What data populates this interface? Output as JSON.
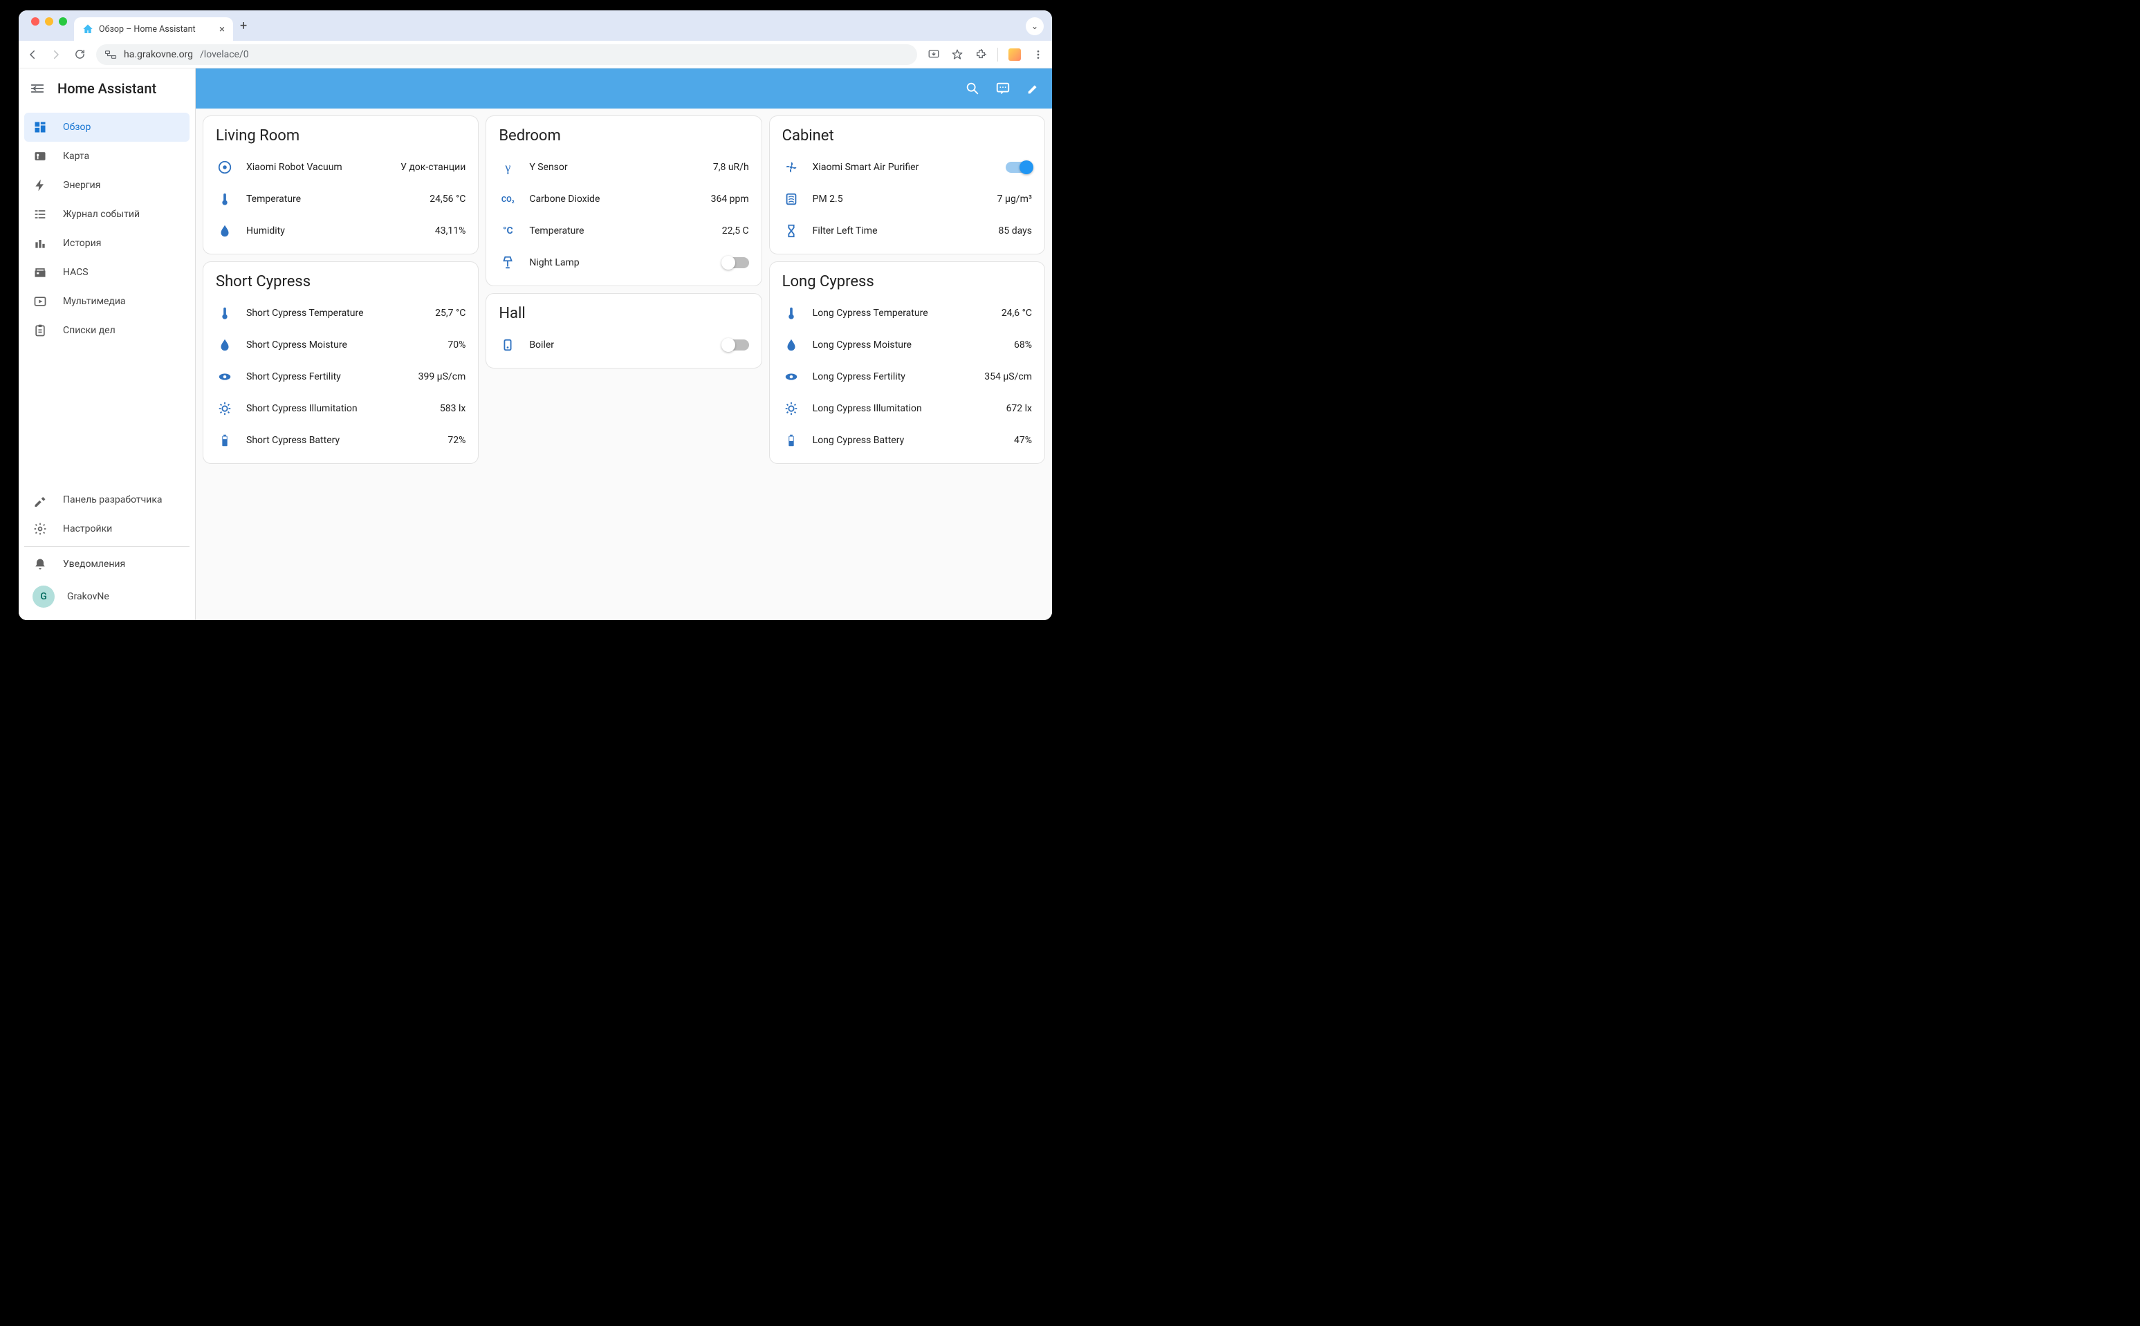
{
  "browser": {
    "tab_title": "Обзор – Home Assistant",
    "url_host": "ha.grakovne.org",
    "url_path": "/lovelace/0"
  },
  "sidebar": {
    "title": "Home Assistant",
    "items": [
      {
        "label": "Обзор",
        "icon": "dashboard-icon",
        "active": true
      },
      {
        "label": "Карта",
        "icon": "map-icon"
      },
      {
        "label": "Энергия",
        "icon": "energy-icon"
      },
      {
        "label": "Журнал событий",
        "icon": "logbook-icon"
      },
      {
        "label": "История",
        "icon": "history-icon"
      },
      {
        "label": "HACS",
        "icon": "hacs-icon"
      },
      {
        "label": "Мультимедиа",
        "icon": "media-icon"
      },
      {
        "label": "Списки дел",
        "icon": "todo-icon"
      }
    ],
    "bottom": [
      {
        "label": "Панель разработчика",
        "icon": "hammer-icon"
      },
      {
        "label": "Настройки",
        "icon": "gear-icon"
      }
    ],
    "notifications": "Уведомления",
    "user_name": "GrakovNe",
    "user_initial": "G"
  },
  "cards": {
    "living_room": {
      "title": "Living Room",
      "rows": [
        {
          "icon": "vacuum-icon",
          "label": "Xiaomi Robot Vacuum",
          "value": "У док-станции"
        },
        {
          "icon": "thermometer-icon",
          "label": "Temperature",
          "value": "24,56 °C"
        },
        {
          "icon": "water-icon",
          "label": "Humidity",
          "value": "43,11%"
        }
      ]
    },
    "short_cypress": {
      "title": "Short Cypress",
      "rows": [
        {
          "icon": "thermometer-icon",
          "label": "Short Cypress Temperature",
          "value": "25,7 °C"
        },
        {
          "icon": "water-icon",
          "label": "Short Cypress Moisture",
          "value": "70%"
        },
        {
          "icon": "eye-icon",
          "label": "Short Cypress Fertility",
          "value": "399 µS/cm"
        },
        {
          "icon": "gear-outline-icon",
          "label": "Short Cypress Illumitation",
          "value": "583 lx"
        },
        {
          "icon": "battery-icon",
          "label": "Short Cypress Battery",
          "value": "72%"
        }
      ]
    },
    "bedroom": {
      "title": "Bedroom",
      "rows": [
        {
          "icon": "gamma-icon",
          "label": "Y Sensor",
          "value": "7,8 uR/h"
        },
        {
          "icon": "co2-icon",
          "label": "Carbone Dioxide",
          "value": "364 ppm"
        },
        {
          "icon": "celsius-icon",
          "label": "Temperature",
          "value": "22,5 C"
        },
        {
          "icon": "lamp-icon",
          "label": "Night Lamp",
          "value": "",
          "switch": "off"
        }
      ]
    },
    "hall": {
      "title": "Hall",
      "rows": [
        {
          "icon": "boiler-icon",
          "label": "Boiler",
          "value": "",
          "switch": "off"
        }
      ]
    },
    "cabinet": {
      "title": "Cabinet",
      "rows": [
        {
          "icon": "fan-icon",
          "label": "Xiaomi Smart Air Purifier",
          "value": "",
          "switch": "on"
        },
        {
          "icon": "filter-icon",
          "label": "PM 2.5",
          "value": "7 µg/m³"
        },
        {
          "icon": "hourglass-icon",
          "label": "Filter Left Time",
          "value": "85 days"
        }
      ]
    },
    "long_cypress": {
      "title": "Long Cypress",
      "rows": [
        {
          "icon": "thermometer-icon",
          "label": "Long Cypress Temperature",
          "value": "24,6 °C"
        },
        {
          "icon": "water-icon",
          "label": "Long Cypress Moisture",
          "value": "68%"
        },
        {
          "icon": "eye-icon",
          "label": "Long Cypress Fertility",
          "value": "354 µS/cm"
        },
        {
          "icon": "gear-outline-icon",
          "label": "Long Cypress Illumitation",
          "value": "672 lx"
        },
        {
          "icon": "battery-icon",
          "label": "Long Cypress Battery",
          "value": "47%"
        }
      ]
    }
  }
}
